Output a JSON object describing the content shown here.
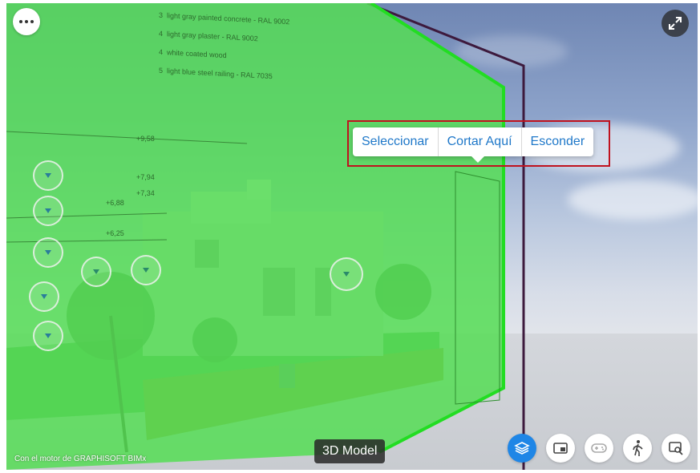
{
  "context_menu": {
    "items": [
      "Seleccionar",
      "Cortar Aquí",
      "Esconder"
    ]
  },
  "footer": {
    "engine_credit": "Con el motor de GRAPHISOFT BIMx",
    "view_label": "3D Model"
  },
  "elevation_markers": [
    "+9,58",
    "+7,94",
    "+7,34",
    "+6,88",
    "+6,25"
  ],
  "legend_left": [
    {
      "num": "3",
      "text": "light gray painted concrete - RAL 9002"
    },
    {
      "num": "4",
      "text": "light gray plaster - RAL 9002"
    },
    {
      "num": "4",
      "text": "white coated wood"
    },
    {
      "num": "5",
      "text": "light blue steel railing - RAL 7035"
    }
  ],
  "toolbar": {
    "buttons": [
      {
        "icon": "layers-icon",
        "active": true
      },
      {
        "icon": "picture-in-picture-icon",
        "active": false
      },
      {
        "icon": "gamepad-icon",
        "active": false
      },
      {
        "icon": "walk-icon",
        "active": false
      },
      {
        "icon": "zoom-screen-icon",
        "active": false
      }
    ]
  },
  "colors": {
    "section_plane": "#5ee05e",
    "section_edge": "#22dd22",
    "outline_frame": "#3d1a3d",
    "context_outline": "#c0121e",
    "menu_text": "#1f78c9",
    "active_tool": "#1f86e6"
  }
}
